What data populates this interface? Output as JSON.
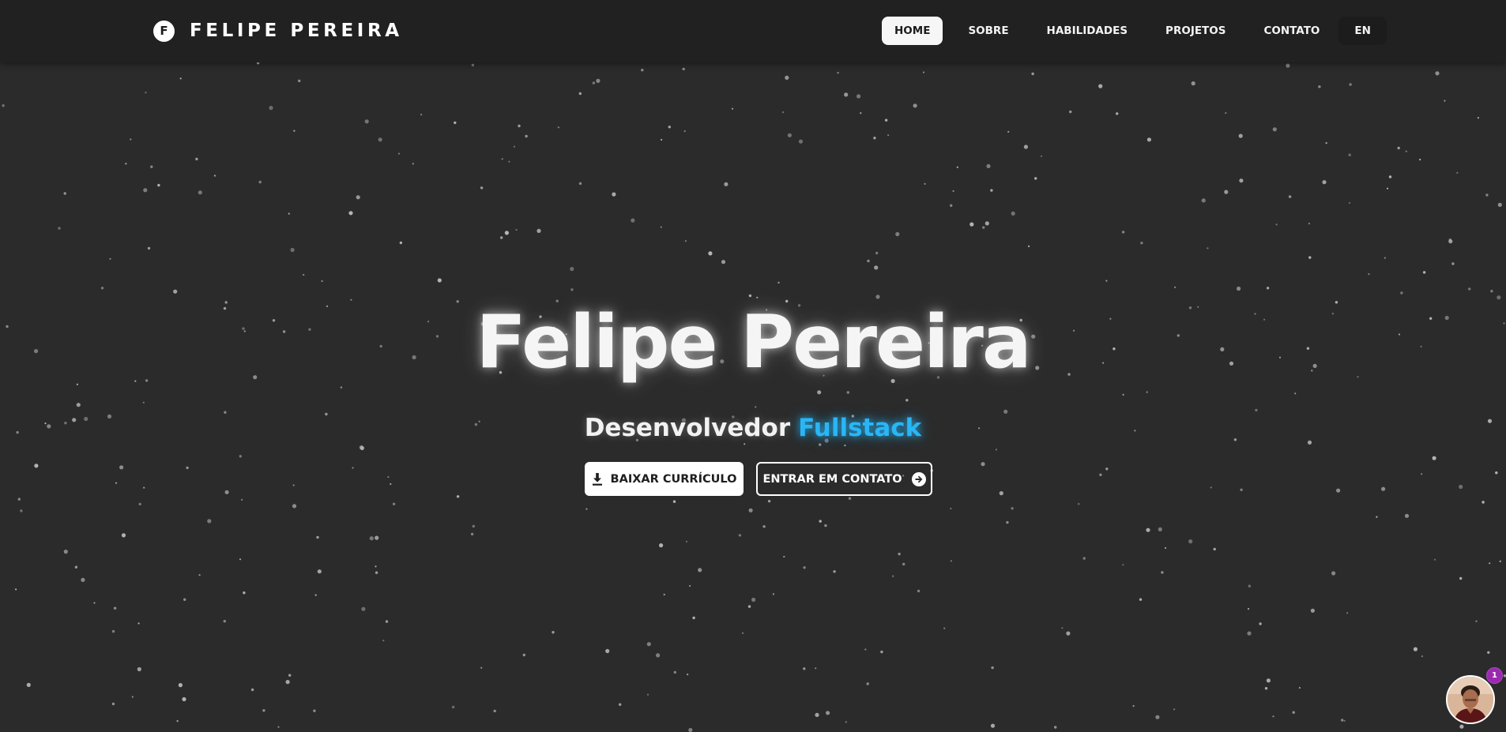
{
  "header": {
    "logo_letter": "F",
    "brand": "FELIPE PEREIRA",
    "nav": [
      {
        "label": "HOME",
        "active": true
      },
      {
        "label": "SOBRE",
        "active": false
      },
      {
        "label": "HABILIDADES",
        "active": false
      },
      {
        "label": "PROJETOS",
        "active": false
      },
      {
        "label": "CONTATO",
        "active": false
      }
    ],
    "language_button": "EN"
  },
  "hero": {
    "title": "Felipe Pereira",
    "subtitle_prefix": "Desenvolvedor",
    "subtitle_accent": "Fullstack",
    "download_button": "BAIXAR CURRÍCULO",
    "contact_button": "ENTRAR EM CONTATO"
  },
  "chat_widget": {
    "badge_count": "1"
  },
  "colors": {
    "background": "#2b2b2b",
    "header": "#212121",
    "accent": "#29b6f6",
    "badge": "#9c27b0",
    "text": "#f5f5f5"
  },
  "icons": {
    "download": "download-icon",
    "contact": "arrow-right-circle-icon"
  }
}
